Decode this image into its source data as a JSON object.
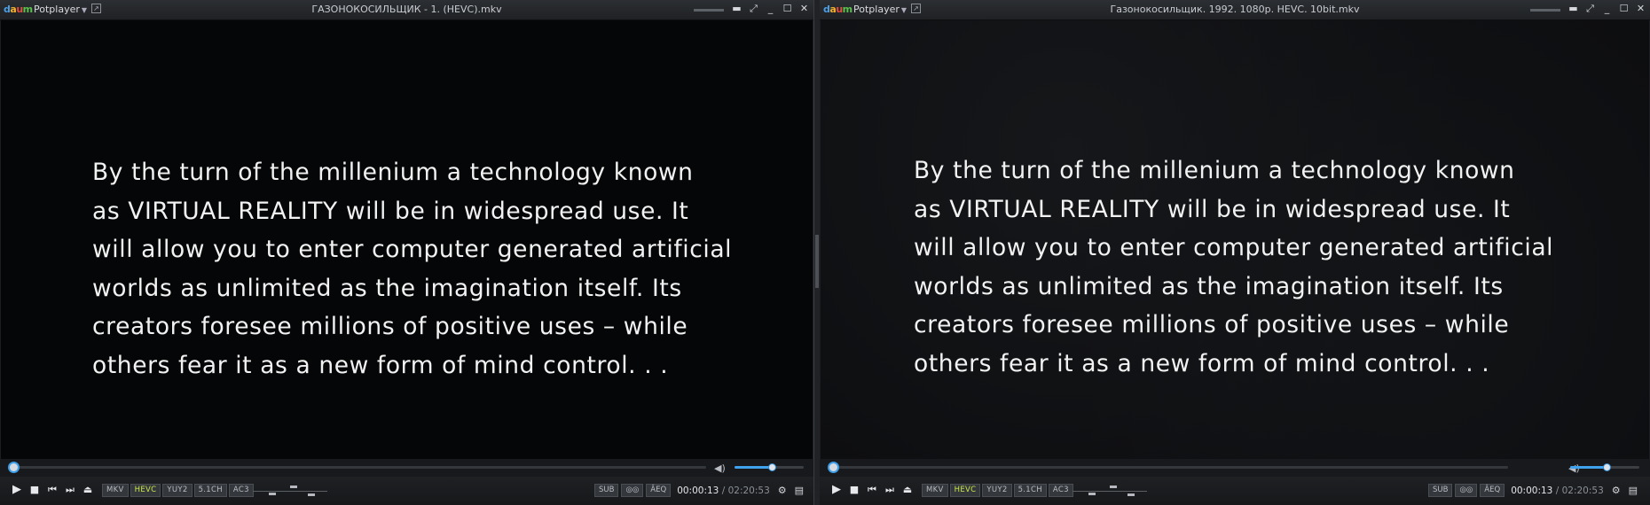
{
  "app": {
    "name": "Potplayer",
    "logo_text": "daum"
  },
  "players": [
    {
      "title": "ГАЗОНОКОСИЛЬЩИК - 1. (HEVC).mkv",
      "subtitle_lines": [
        "By the turn of the millenium a technology known",
        "as VIRTUAL REALITY will be in widespread use. It",
        "will allow you to enter computer generated artificial",
        "worlds as unlimited as the imagination itself. Its",
        "creators foresee millions of positive uses – while",
        "others fear it as a new form of mind control. . ."
      ],
      "badges": [
        "MKV",
        "HEVC",
        "YUY2",
        "5.1CH",
        "AC3"
      ],
      "sub_label": "SUB",
      "eq_label": "ÂEQ",
      "current_time": "00:00:13",
      "separator": "/",
      "duration": "02:20:53",
      "seek_progress": 0.001,
      "volume_level": 0.54
    },
    {
      "title": "Газонокосильщик. 1992. 1080p. HEVC. 10bit.mkv",
      "subtitle_lines": [
        "By the turn of the millenium a technology known",
        "as VIRTUAL REALITY will be in widespread use. It",
        "will allow you to enter computer generated artificial",
        "worlds as unlimited as the imagination itself. Its",
        "creators foresee millions of positive uses – while",
        "others fear it as a new form of mind control. . ."
      ],
      "badges": [
        "MKV",
        "HEVC",
        "YUY2",
        "5.1CH",
        "AC3"
      ],
      "sub_label": "SUB",
      "eq_label": "ÂEQ",
      "current_time": "00:00:13",
      "separator": "/",
      "duration": "02:20:53",
      "seek_progress": 0.001,
      "volume_level": 0.52
    }
  ],
  "icons": {
    "pin": "pin-icon",
    "fullscreen": "fullscreen-icon",
    "minimize": "minimize-icon",
    "maximize": "maximize-icon",
    "close": "close-icon",
    "play": "play-icon",
    "stop": "stop-icon",
    "prev": "previous-icon",
    "next": "next-icon",
    "eject": "eject-icon",
    "volume": "speaker-icon",
    "vr": "vr-glasses-icon",
    "settings": "gear-icon",
    "playlist": "playlist-icon"
  },
  "colors": {
    "accent": "#3ea2ec",
    "highlight_badge": "#c9e84a",
    "video_bg": "#050607"
  }
}
